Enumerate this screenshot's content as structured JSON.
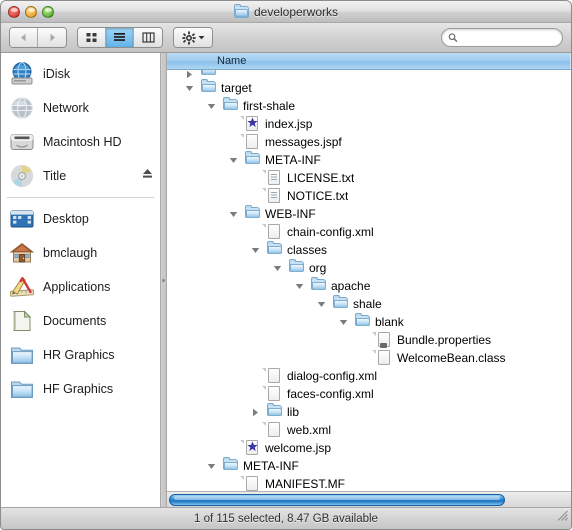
{
  "window": {
    "title": "developerworks",
    "title_icon": "folder-icon",
    "controls": [
      {
        "name": "close-button",
        "label": "Close"
      },
      {
        "name": "minimize-button",
        "label": "Minimize"
      },
      {
        "name": "zoom-button",
        "label": "Zoom"
      }
    ]
  },
  "toolbar": {
    "back_label": "Back",
    "forward_label": "Forward",
    "view_icon_label": "Icon View",
    "view_list_label": "List View",
    "view_column_label": "Column View",
    "action_label": "Action",
    "active_view": "list"
  },
  "search": {
    "placeholder": "",
    "value": "",
    "icon": "search-icon"
  },
  "sidebar": {
    "groups": [
      {
        "items": [
          {
            "label": "iDisk",
            "icon": "idisk-icon",
            "ejectable": false
          },
          {
            "label": "Network",
            "icon": "network-icon",
            "ejectable": false
          },
          {
            "label": "Macintosh HD",
            "icon": "harddisk-icon",
            "ejectable": false
          },
          {
            "label": "Title",
            "icon": "cd-icon",
            "ejectable": true
          }
        ]
      },
      {
        "items": [
          {
            "label": "Desktop",
            "icon": "desktop-icon",
            "ejectable": false
          },
          {
            "label": "bmclaugh",
            "icon": "home-icon",
            "ejectable": false
          },
          {
            "label": "Applications",
            "icon": "applications-icon",
            "ejectable": false
          },
          {
            "label": "Documents",
            "icon": "documents-icon",
            "ejectable": false
          },
          {
            "label": "HR Graphics",
            "icon": "folder-icon",
            "ejectable": false
          },
          {
            "label": "HF Graphics",
            "icon": "folder-icon",
            "ejectable": false
          }
        ]
      }
    ]
  },
  "list": {
    "column_header": "Name",
    "sorted_column": "Name",
    "rows": [
      {
        "label": "",
        "indent": 1,
        "icon": "folder-icon",
        "twisty": "collapsed",
        "clipped": true
      },
      {
        "label": "target",
        "indent": 1,
        "icon": "folder-icon",
        "twisty": "expanded"
      },
      {
        "label": "first-shale",
        "indent": 2,
        "icon": "folder-icon",
        "twisty": "expanded"
      },
      {
        "label": "index.jsp",
        "indent": 3,
        "icon": "jsp-file-icon",
        "twisty": "none"
      },
      {
        "label": "messages.jspf",
        "indent": 3,
        "icon": "file-icon",
        "twisty": "none"
      },
      {
        "label": "META-INF",
        "indent": 3,
        "icon": "folder-icon",
        "twisty": "expanded"
      },
      {
        "label": "LICENSE.txt",
        "indent": 4,
        "icon": "text-file-icon",
        "twisty": "none"
      },
      {
        "label": "NOTICE.txt",
        "indent": 4,
        "icon": "text-file-icon",
        "twisty": "none"
      },
      {
        "label": "WEB-INF",
        "indent": 3,
        "icon": "folder-icon",
        "twisty": "expanded"
      },
      {
        "label": "chain-config.xml",
        "indent": 4,
        "icon": "file-icon",
        "twisty": "none"
      },
      {
        "label": "classes",
        "indent": 4,
        "icon": "folder-icon",
        "twisty": "expanded"
      },
      {
        "label": "org",
        "indent": 5,
        "icon": "folder-icon",
        "twisty": "expanded"
      },
      {
        "label": "apache",
        "indent": 6,
        "icon": "folder-icon",
        "twisty": "expanded"
      },
      {
        "label": "shale",
        "indent": 7,
        "icon": "folder-icon",
        "twisty": "expanded"
      },
      {
        "label": "blank",
        "indent": 8,
        "icon": "folder-icon",
        "twisty": "expanded"
      },
      {
        "label": "Bundle.properties",
        "indent": 9,
        "icon": "file-icon",
        "twisty": "none"
      },
      {
        "label": "WelcomeBean.class",
        "indent": 9,
        "icon": "class-file-icon",
        "twisty": "none"
      },
      {
        "label": "dialog-config.xml",
        "indent": 4,
        "icon": "file-icon",
        "twisty": "none"
      },
      {
        "label": "faces-config.xml",
        "indent": 4,
        "icon": "file-icon",
        "twisty": "none"
      },
      {
        "label": "lib",
        "indent": 4,
        "icon": "folder-icon",
        "twisty": "collapsed"
      },
      {
        "label": "web.xml",
        "indent": 4,
        "icon": "file-icon",
        "twisty": "none"
      },
      {
        "label": "welcome.jsp",
        "indent": 3,
        "icon": "jsp-file-icon",
        "twisty": "none"
      },
      {
        "label": "META-INF",
        "indent": 2,
        "icon": "folder-icon",
        "twisty": "expanded"
      },
      {
        "label": "MANIFEST.MF",
        "indent": 3,
        "icon": "file-icon",
        "twisty": "none"
      }
    ]
  },
  "scrollbar": {
    "horizontal_thumb_percent": 84
  },
  "status": {
    "text": "1 of 115 selected, 8.47 GB available"
  },
  "colors": {
    "header_blue": "#9ecbee",
    "scroll_blue": "#2f8fd8",
    "window_gray": "#d6d6d6"
  }
}
